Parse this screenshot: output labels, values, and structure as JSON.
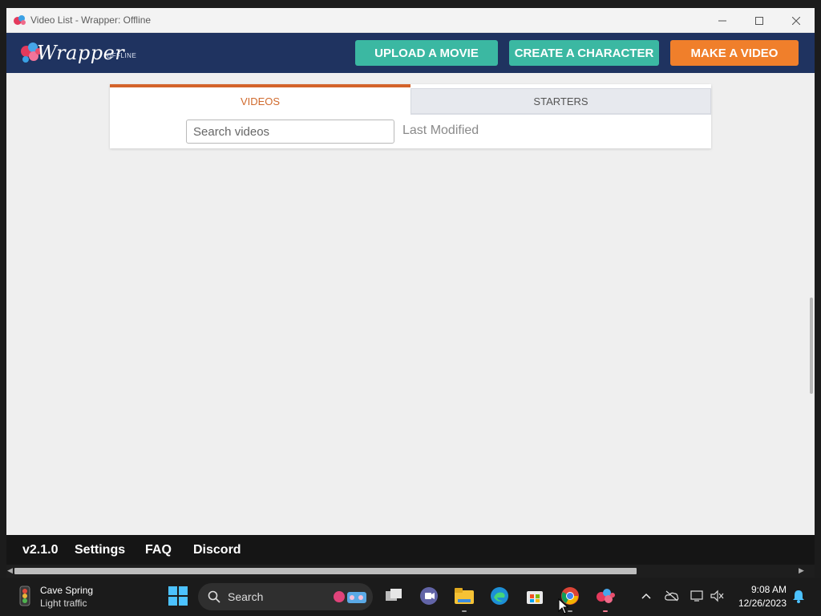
{
  "window": {
    "title": "Video List - Wrapper: Offline",
    "controls": [
      "minimize",
      "maximize",
      "close"
    ]
  },
  "header": {
    "logo_text": "Wrapper",
    "logo_sub": "OFFLINE",
    "buttons": {
      "upload": "UPLOAD A MOVIE",
      "create": "CREATE A CHARACTER",
      "make": "MAKE A VIDEO"
    }
  },
  "tabs": {
    "videos": "VIDEOS",
    "starters": "STARTERS",
    "active": "videos"
  },
  "search": {
    "placeholder": "Search videos",
    "value": ""
  },
  "sort": {
    "label": "Last Modified"
  },
  "footer": {
    "version": "v2.1.0",
    "settings": "Settings",
    "faq": "FAQ",
    "discord": "Discord"
  },
  "taskbar": {
    "weather": {
      "city": "Cave Spring",
      "condition": "Light traffic"
    },
    "search_label": "Search",
    "clock": {
      "time": "9:08 AM",
      "date": "12/26/2023"
    },
    "apps": [
      "windows-start",
      "task-view",
      "teams",
      "file-explorer",
      "edge",
      "microsoft-store",
      "chrome",
      "wrapper-offline"
    ]
  },
  "colors": {
    "header_bg": "#1f3360",
    "teal_button": "#3bb8a2",
    "orange_button": "#f07f2b",
    "active_tab": "#d4632a",
    "footer_bg": "#151515"
  }
}
